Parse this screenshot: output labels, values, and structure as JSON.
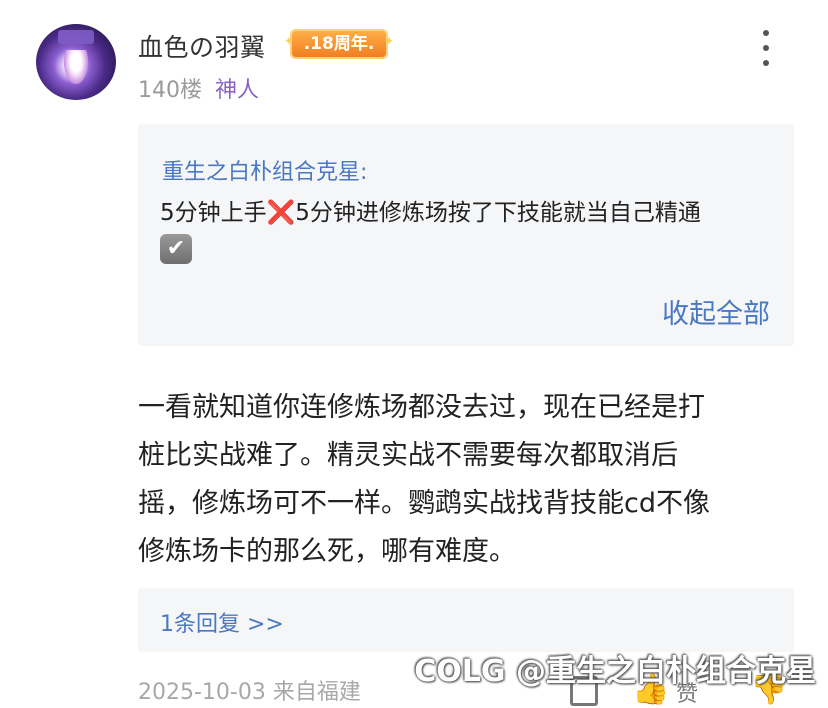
{
  "user": {
    "name": "血色の羽翼",
    "badge": ".18周年.",
    "floor": "140楼",
    "rank": "神人"
  },
  "quote": {
    "author": "重生之白朴组合克星:",
    "text_part1": "5分钟上手",
    "cross_icon": "❌",
    "text_part2": "5分钟进修炼场按了下技能就当自己精通",
    "check_icon": "✔",
    "collapse_label": "收起全部"
  },
  "post": {
    "lines": [
      "一看就知道你连修炼场都没去过，现在已经是打",
      "桩比实战难了。精灵实战不需要每次都取消后",
      "摇，修炼场可不一样。鹦鹉实战找背技能cd不像",
      "修炼场卡的那么死，哪有难度。"
    ]
  },
  "replies": {
    "label": "1条回复 >>"
  },
  "meta": {
    "date_location": "2025-10-03 来自福建",
    "like_label": "赞"
  },
  "watermark": "COLG @重生之白朴组合克星",
  "icons": {
    "more": "more-vertical-icon",
    "reply": "comment-icon",
    "like": "thumb-up-icon",
    "dislike": "thumb-down-icon"
  },
  "colors": {
    "link_blue": "#4a78c2",
    "rank_purple": "#8a63c9",
    "badge_orange": "#f07a1f"
  }
}
